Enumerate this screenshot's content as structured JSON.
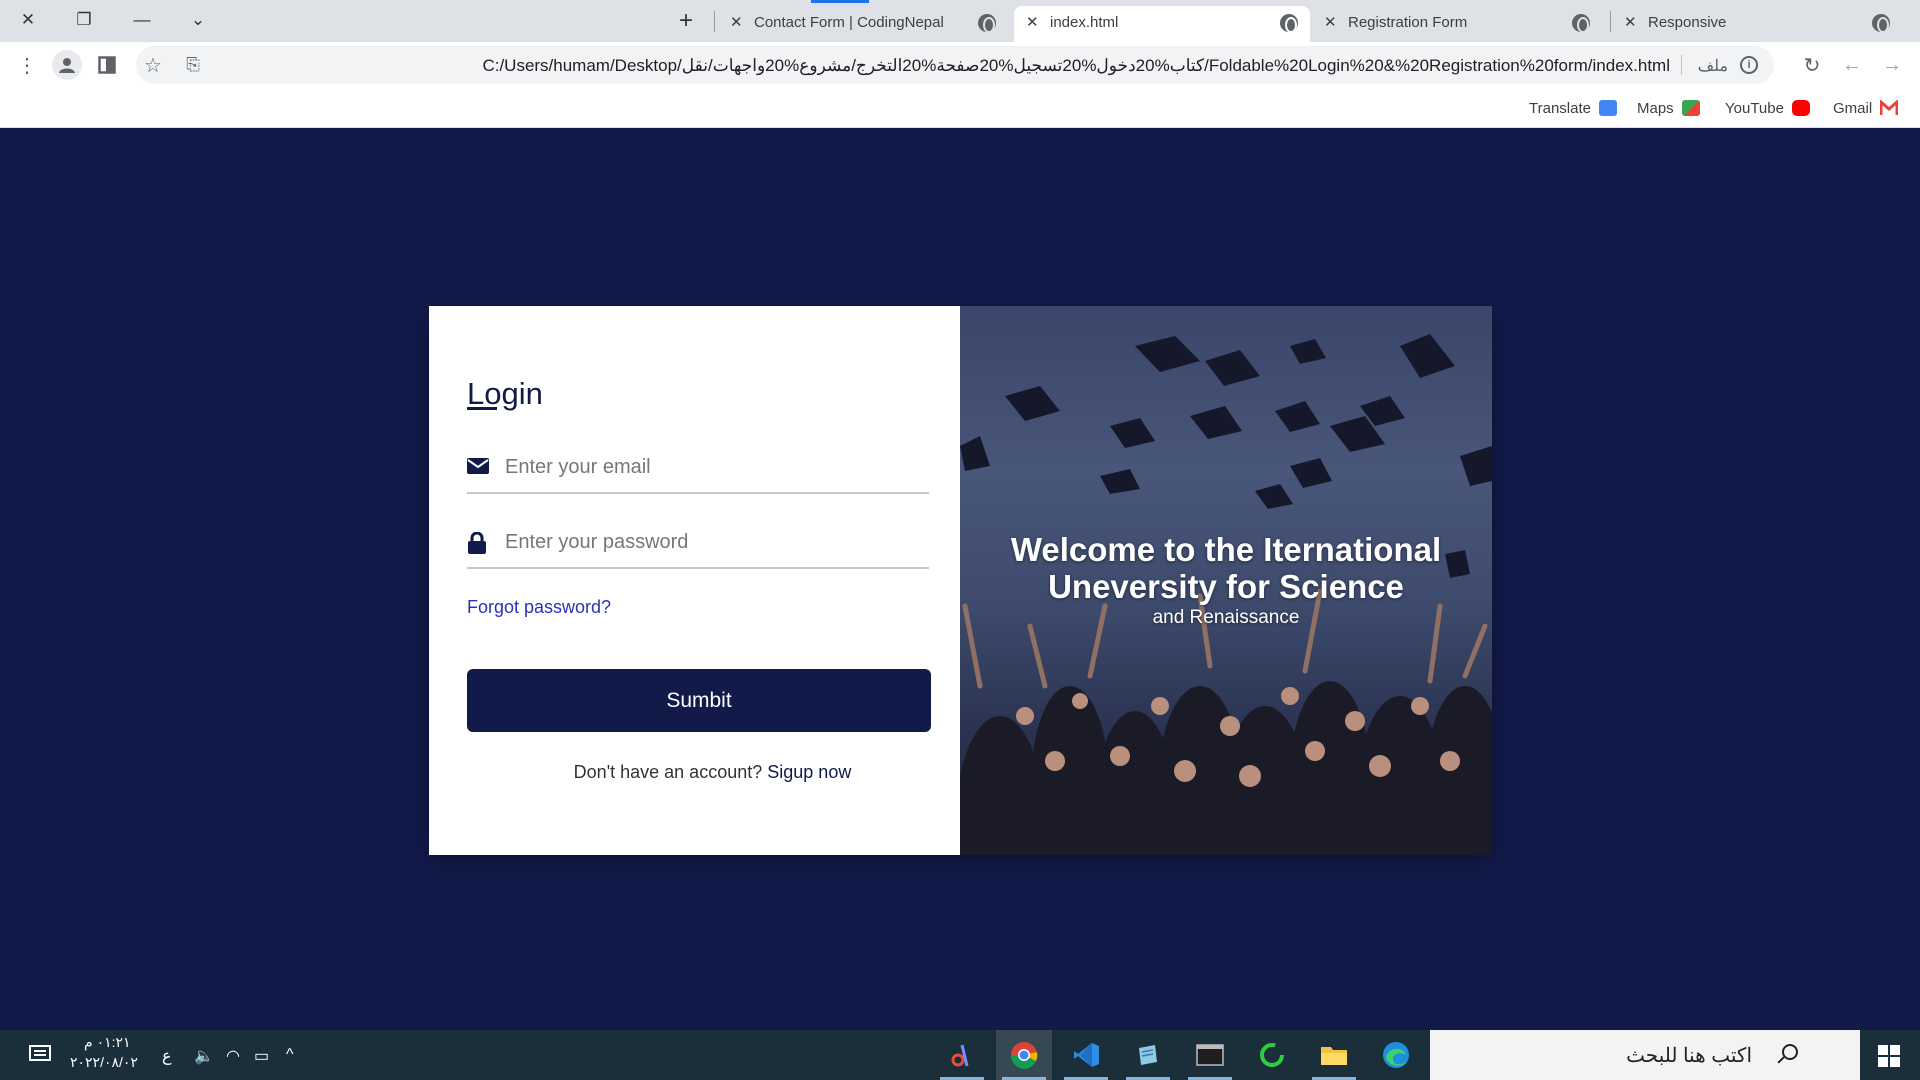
{
  "browser": {
    "tabs": [
      {
        "label": "Contact Form | CodingNepal",
        "active": false
      },
      {
        "label": "index.html",
        "active": true
      },
      {
        "label": "Registration Form",
        "active": false
      },
      {
        "label": "Responsive",
        "active": false
      }
    ],
    "address_bar": {
      "url": "C:/Users/humam/Desktop/كتاب%20دخول%20تسجيل%20صفحة%20التخرج/مشروع%20واجهات/نقل/Foldable%20Login%20&%20Registration%20form/index.html",
      "scheme_label": "ملف"
    },
    "bookmarks": [
      {
        "label": "Translate",
        "icon": "google-translate-icon",
        "color": "#4285f4"
      },
      {
        "label": "Maps",
        "icon": "google-maps-icon",
        "color": "#34a853"
      },
      {
        "label": "YouTube",
        "icon": "youtube-icon",
        "color": "#ff0000"
      },
      {
        "label": "Gmail",
        "icon": "gmail-icon",
        "color": "#ea4335"
      }
    ]
  },
  "login": {
    "title": "Login",
    "email_placeholder": "Enter your email",
    "password_placeholder": "Enter your password",
    "forgot_label": "Forgot password?",
    "submit_label": "Sumbit",
    "signup_prompt": "Don't have an account?",
    "signup_link": "Sigup now"
  },
  "hero": {
    "title": "Welcome to the Iternational Uneversity for Science",
    "subtitle": "and Renaissance"
  },
  "taskbar": {
    "search_placeholder": "اكتب هنا للبحث",
    "time": "٠١:٢١ م",
    "date": "٢٠٢٢/٠٨/٠٢",
    "language": "ع",
    "apps": [
      "snipping-tool-icon",
      "chrome-icon",
      "vscode-icon",
      "notepad-icon",
      "terminal-icon",
      "refresh-app-icon",
      "file-explorer-icon",
      "edge-icon"
    ]
  },
  "colors": {
    "page_bg": "#121a4a",
    "accent": "#121a4a",
    "link": "#2a32b8"
  }
}
